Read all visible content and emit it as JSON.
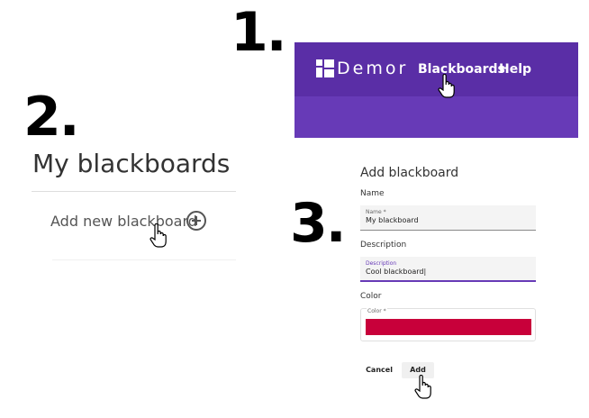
{
  "steps": {
    "one": "1.",
    "two": "2.",
    "three": "3."
  },
  "app": {
    "brand": "Demor",
    "nav": {
      "blackboards": "Blackboards",
      "help": "Help"
    },
    "colors": {
      "appbar": "#673ab7",
      "appbar_top": "#5a2ea6"
    }
  },
  "page": {
    "title": "My blackboards",
    "add_new_label": "Add new blackboard"
  },
  "dialog": {
    "title": "Add blackboard",
    "name_section": "Name",
    "name_field": {
      "label": "Name *",
      "value": "My blackboard"
    },
    "description_section": "Description",
    "description_field": {
      "label": "Description",
      "value": "Cool blackboard|"
    },
    "color_section": "Color",
    "color_field": {
      "label": "Color *",
      "value": "#c8003a"
    },
    "cancel_label": "Cancel",
    "add_label": "Add"
  },
  "icons": [
    "logo-icon",
    "plus-circle-icon",
    "hand-cursor-icon"
  ]
}
